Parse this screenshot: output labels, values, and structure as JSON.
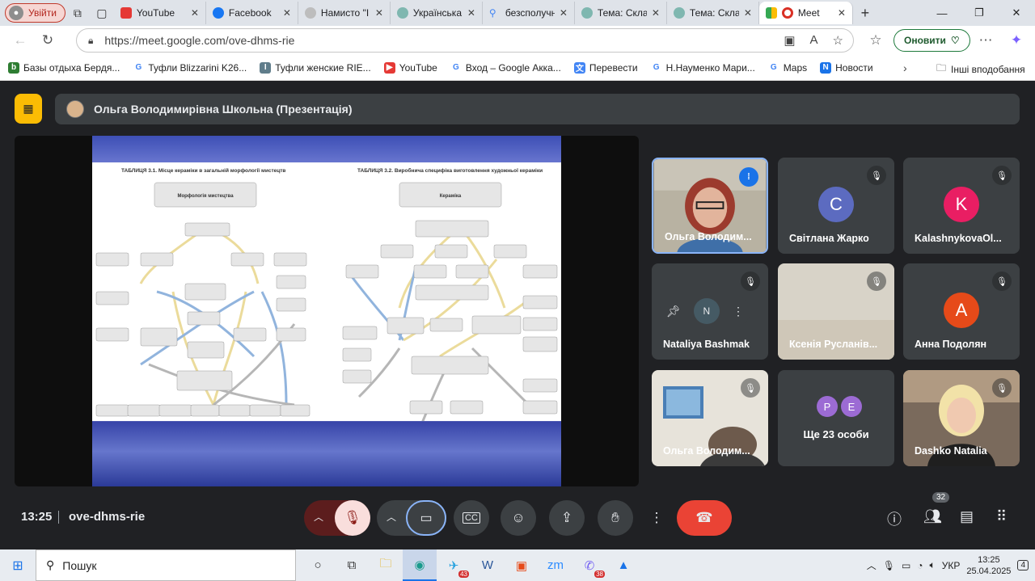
{
  "browser": {
    "profile_label": "Увійти",
    "tabs": [
      {
        "title": "YouTube",
        "color": "#e53935"
      },
      {
        "title": "Facebook",
        "color": "#1877f2"
      },
      {
        "title": "Намисто \"I",
        "color": "#9e9e9e"
      },
      {
        "title": "Українська",
        "color": "#5aa"
      },
      {
        "title": "безсполучн",
        "color": "#4285f4"
      },
      {
        "title": "Тема: Скла",
        "color": "#5aa"
      },
      {
        "title": "Тема: Скла",
        "color": "#5aa"
      },
      {
        "title": "Meet",
        "color": "#00897b"
      }
    ],
    "url": "https://meet.google.com/ove-dhms-rie",
    "update_label": "Оновити",
    "bookmarks": [
      {
        "label": "Базы отдыха Бердя...",
        "icon": "bd-icon",
        "color": "#2e7d32"
      },
      {
        "label": "Туфли Blizzarini K26...",
        "icon": "google-icon",
        "color": "#4285f4"
      },
      {
        "label": "Туфли женские RIE...",
        "icon": "in-icon",
        "color": "#607d8b"
      },
      {
        "label": "YouTube",
        "icon": "youtube-icon",
        "color": "#e53935"
      },
      {
        "label": "Вход – Google Акка...",
        "icon": "google-icon",
        "color": "#4285f4"
      },
      {
        "label": "Перевести",
        "icon": "translate-icon",
        "color": "#4285f4"
      },
      {
        "label": "Н.Науменко Мари...",
        "icon": "google-icon",
        "color": "#4285f4"
      },
      {
        "label": "Maps",
        "icon": "google-icon",
        "color": "#4285f4"
      },
      {
        "label": "Новости",
        "icon": "news-icon",
        "color": "#1a73e8"
      }
    ],
    "other_bookmarks": "Інші вподобання"
  },
  "meet": {
    "presenter": "Ольга Володимирівна Школьна (Презентація)",
    "slide": {
      "title_left": "ТАБЛИЦЯ 3.1. Місце кераміки в загальній морфології мистецтв",
      "title_right": "ТАБЛИЦЯ 3.2. Виробнича специфіка виготовлення художньої кераміки",
      "box_left": "Морфологія мистецтва",
      "box_right": "Кераміка"
    },
    "participants": [
      {
        "name": "Ольга Володим...",
        "speaking": true
      },
      {
        "name": "Світлана Жарко",
        "initial": "С",
        "color": "#5c6bc0"
      },
      {
        "name": "KalashnykovaOl...",
        "initial": "K",
        "color": "#e91e63"
      },
      {
        "name": "Nataliya Bashmak"
      },
      {
        "name": "Ксенія Русланів..."
      },
      {
        "name": "Анна Подолян",
        "initial": "A",
        "color": "#e64a19"
      },
      {
        "name": "Ольга Володим..."
      },
      {
        "name": "Ще 23 особи",
        "more_initials": [
          "P",
          "E"
        ]
      },
      {
        "name": "Dashko Natalia"
      }
    ],
    "time": "13:25",
    "meeting_code": "ove-dhms-rie",
    "participants_count": "32"
  },
  "taskbar": {
    "search_label": "Пошук",
    "lang": "УКР",
    "time": "13:25",
    "date": "25.04.2025",
    "badges": {
      "telegram": "43",
      "viber": "38",
      "notifications": "4"
    }
  }
}
